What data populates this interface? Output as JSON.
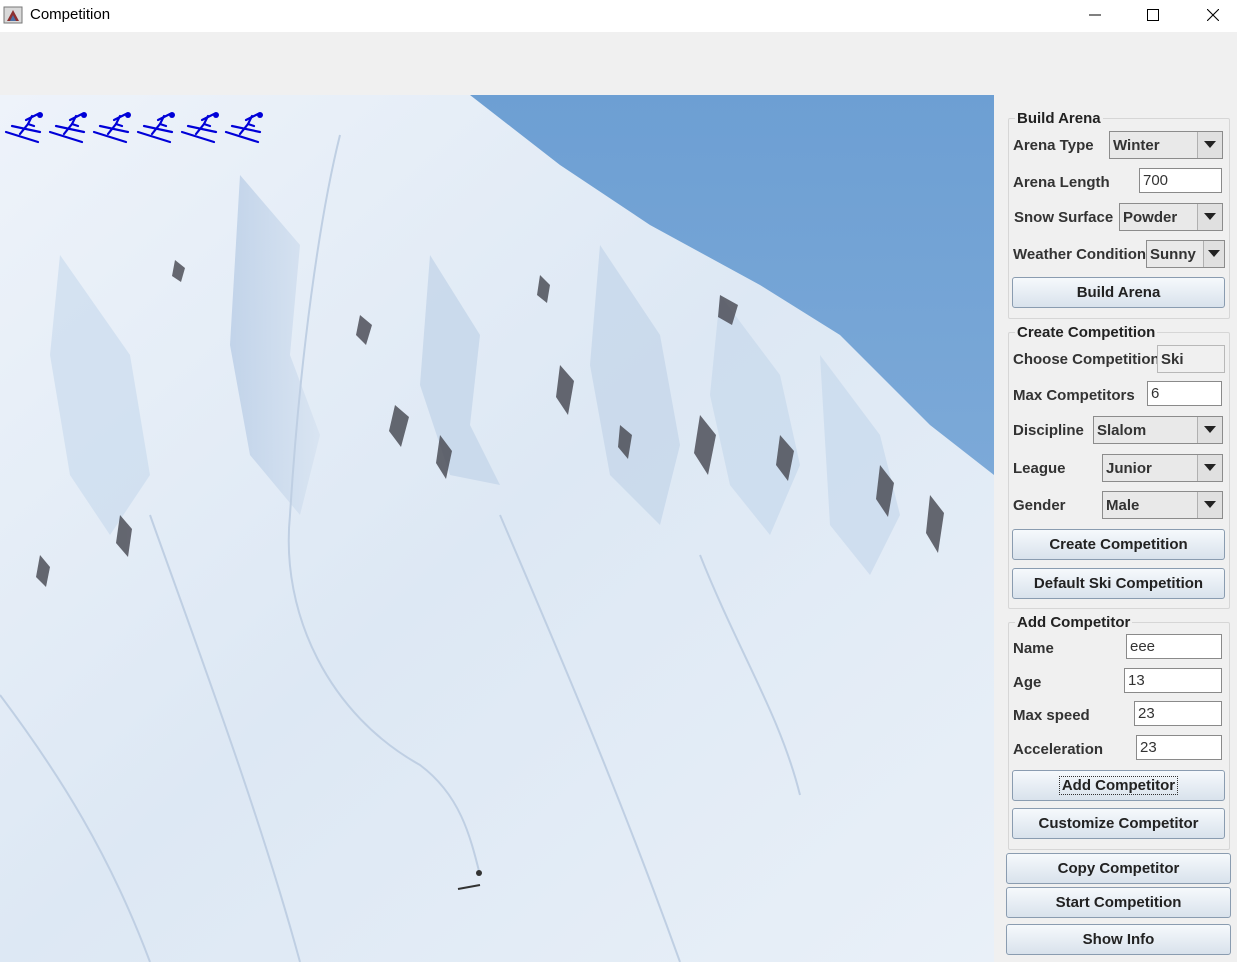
{
  "window": {
    "title": "Competition"
  },
  "skiers": {
    "count": 6,
    "color": "#0000d8"
  },
  "build_arena": {
    "title": "Build Arena",
    "arena_type_label": "Arena Type",
    "arena_type_value": "Winter",
    "arena_length_label": "Arena Length",
    "arena_length_value": "700",
    "snow_surface_label": "Snow Surface",
    "snow_surface_value": "Powder",
    "weather_label": "Weather Condition",
    "weather_value": "Sunny",
    "button": "Build Arena"
  },
  "create_competition": {
    "title": "Create Competition",
    "choose_label": "Choose Competition",
    "choose_value": "Ski",
    "max_label": "Max Competitors",
    "max_value": "6",
    "discipline_label": "Discipline",
    "discipline_value": "Slalom",
    "league_label": "League",
    "league_value": "Junior",
    "gender_label": "Gender",
    "gender_value": "Male",
    "create_button": "Create Competition",
    "default_button": "Default Ski Competition"
  },
  "add_competitor": {
    "title": "Add Competitor",
    "name_label": "Name",
    "name_value": "eee",
    "age_label": "Age",
    "age_value": "13",
    "speed_label": "Max speed",
    "speed_value": "23",
    "accel_label": "Acceleration",
    "accel_value": "23",
    "add_button": "Add Competitor",
    "customize_button": "Customize Competitor"
  },
  "actions": {
    "copy": "Copy Competitor",
    "start": "Start Competition",
    "info": "Show Info"
  }
}
